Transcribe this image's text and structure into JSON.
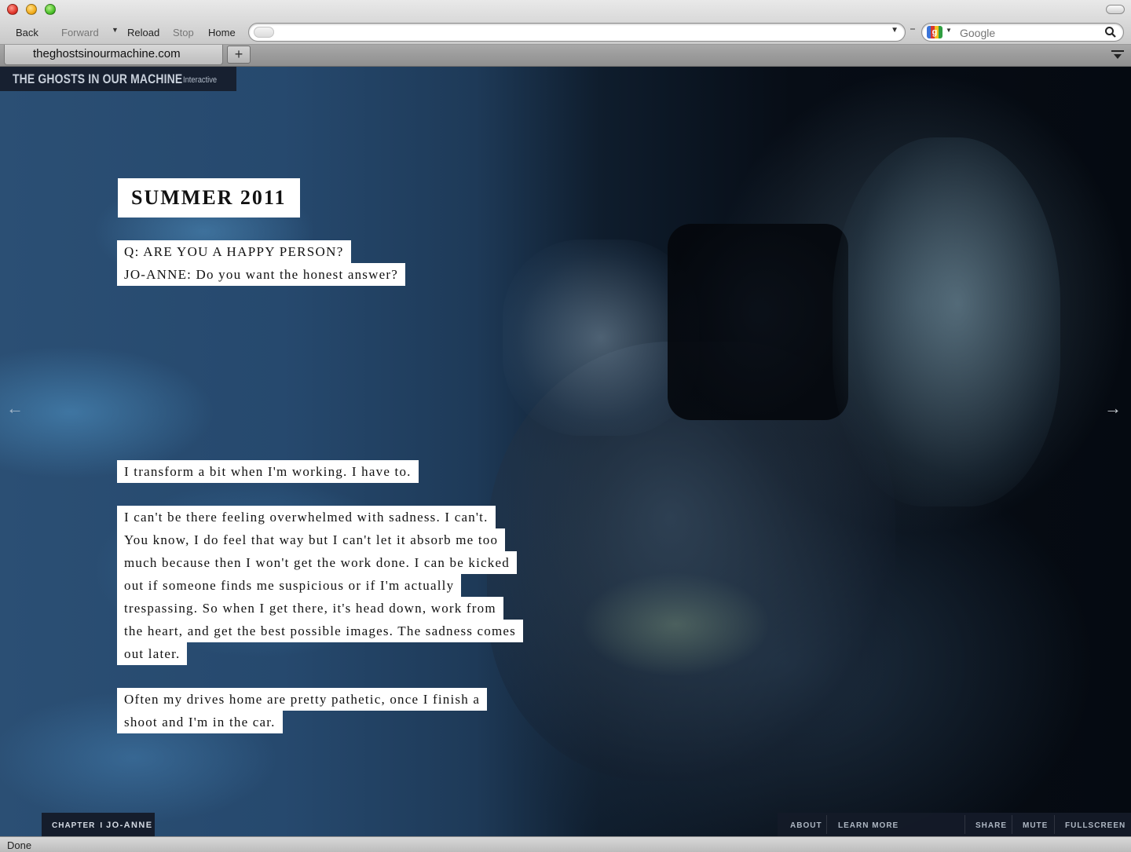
{
  "browser": {
    "nav": {
      "back": "Back",
      "forward": "Forward",
      "reload": "Reload",
      "stop": "Stop",
      "home": "Home"
    },
    "url_value": "",
    "search_placeholder": "Google",
    "tab_title": "theghostsinourmachine.com",
    "new_tab_label": "+",
    "status_text": "Done"
  },
  "site": {
    "brand_title": "THE GHOSTS IN OUR MACHINE",
    "brand_subtitle": "Interactive",
    "prev_arrow": "←",
    "next_arrow": "→",
    "heading": "SUMMER 2011",
    "qa": {
      "question": "Q: ARE YOU A HAPPY PERSON?",
      "answer": "JO-ANNE: Do you want the honest answer?"
    },
    "paragraph1": [
      "I transform a bit when I'm working. I have to."
    ],
    "paragraph2": [
      "I can't be there feeling overwhelmed with sadness. I can't.",
      "You know, I do feel that way but I can't let it absorb me too",
      "much because then I won't get the work done. I can be kicked",
      "out if someone finds me suspicious or if I'm actually",
      "trespassing. So when I get there, it's head down, work from",
      "the heart, and get the best possible images. The sadness comes",
      "out later."
    ],
    "paragraph3": [
      "Often my drives home are pretty pathetic, once I finish a",
      "shoot and I'm in the car."
    ],
    "chapter": {
      "label": "CHAPTER",
      "separator": "I",
      "name": "JO-ANNE"
    },
    "footer_links": {
      "about": "ABOUT",
      "learn_more": "LEARN MORE",
      "share": "SHARE",
      "mute": "MUTE",
      "fullscreen": "FULLSCREEN"
    }
  },
  "colors": {
    "chrome_bg": "#d4d4d4",
    "overlay_dark": "#161c2a",
    "text_box_bg": "#ffffff",
    "text_dark": "#111111"
  }
}
